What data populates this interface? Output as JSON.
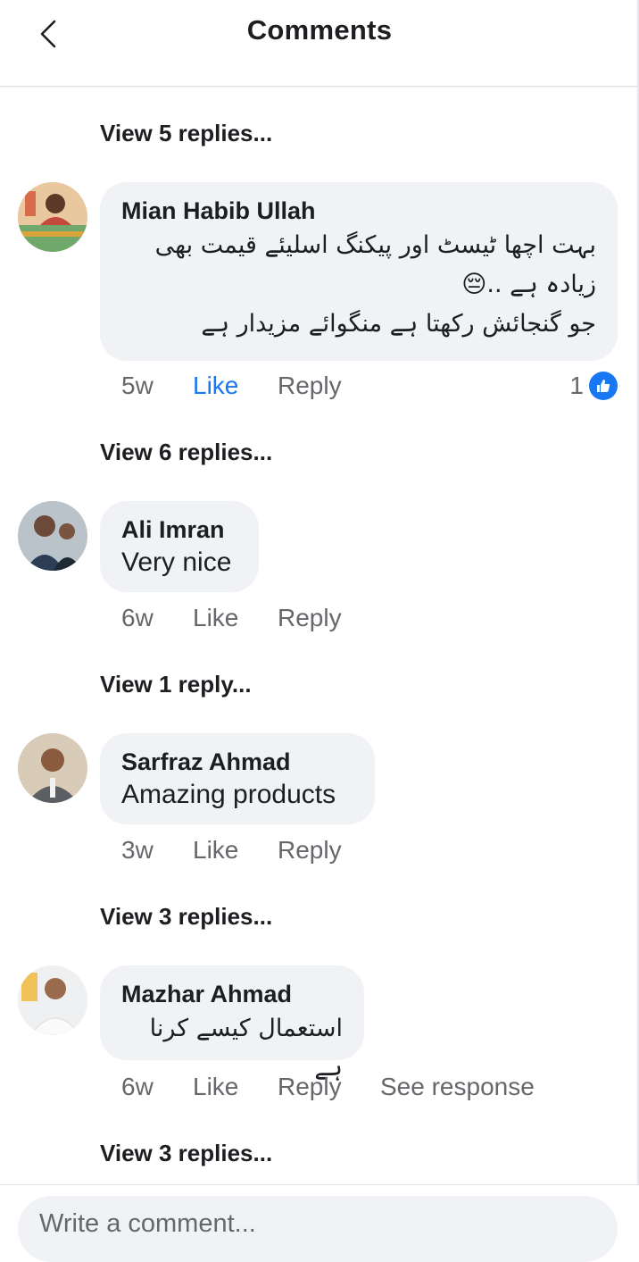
{
  "header": {
    "title": "Comments",
    "back_icon": "chevron-left-icon"
  },
  "colors": {
    "accent": "#1877f2",
    "bubble": "#f0f2f5",
    "muted": "#65676b"
  },
  "replies_links": [
    "View 5 replies...",
    "View 6 replies...",
    "View 1 reply...",
    "View 3 replies...",
    "View 3 replies..."
  ],
  "comments": [
    {
      "author": "Mian Habib Ullah",
      "lines": [
        "بہت اچھا ٹیسٹ اور پیکنگ اسلیئے قیمت بھی",
        "زیادہ ہے ..😔",
        "جو گنجائش رکھتا ہے منگوائے مزیدار ہے"
      ],
      "time": "5w",
      "like": "Like",
      "reply": "Reply",
      "reaction_count": "1",
      "liked": true
    },
    {
      "author": "Ali Imran",
      "text": "Very nice",
      "time": "6w",
      "like": "Like",
      "reply": "Reply"
    },
    {
      "author": "Sarfraz Ahmad",
      "text": "Amazing products",
      "time": "3w",
      "like": "Like",
      "reply": "Reply"
    },
    {
      "author": "Mazhar Ahmad",
      "text": "استعمال کیسے کرنا ہے",
      "time": "6w",
      "like": "Like",
      "reply": "Reply",
      "see_response": "See response"
    }
  ],
  "composer": {
    "placeholder": "Write a comment..."
  }
}
